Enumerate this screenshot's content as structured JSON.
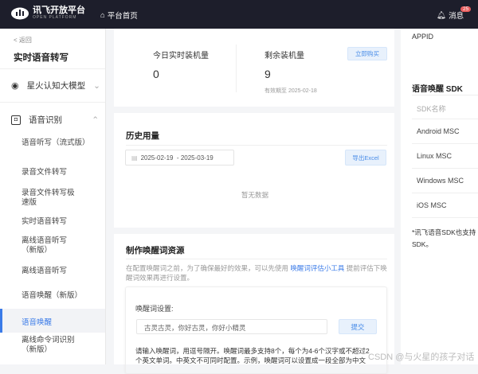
{
  "header": {
    "logo_title": "讯飞开放平台",
    "logo_sub": "OPEN PLATFORM",
    "home_label": "平台首页",
    "messages_label": "消息",
    "messages_count": "25"
  },
  "sidebar": {
    "back_label": "< 返回",
    "page_title": "实时语音转写",
    "groups": [
      {
        "label": "星火认知大模型"
      },
      {
        "label": "语音识别"
      }
    ],
    "items": [
      {
        "label": "语音听写（流式版）"
      },
      {
        "label": "录音文件转写"
      },
      {
        "label": "录音文件转写极速版"
      },
      {
        "label": "实时语音转写"
      },
      {
        "label": "离线语音听写（新版）"
      },
      {
        "label": "离线语音听写"
      },
      {
        "label": "语音唤醒（新版）"
      },
      {
        "label": "语音唤醒",
        "active": true
      },
      {
        "label": "离线命令词识别（新版）"
      }
    ]
  },
  "stats": {
    "today_label": "今日实时装机量",
    "today_value": "0",
    "remaining_label": "剩余装机量",
    "remaining_value": "9",
    "expiry": "有效期至 2025-02-18",
    "buy_label": "立即购买"
  },
  "history": {
    "title": "历史用量",
    "date_range": "2025-02-19  - 2025-03-19",
    "export_label": "导出Excel",
    "empty": "暂无数据"
  },
  "wakeword": {
    "title": "制作唤醒词资源",
    "desc_before": "在配置唤醒词之前，为了确保最好的效果，可以先使用 ",
    "desc_link": "唤醒词评估小工具",
    "desc_after": " 提前评估下唤醒词效果再进行设置。",
    "setting_label": "唤醒词设置:",
    "input_value": "古灵古灵，你好古灵，你好小精灵",
    "submit_label": "提交",
    "hint": "请输入唤醒词，用逗号隔开。唤醒词最多支持8个，每个为4-6个汉字或不超过2个英文单词。中英文不可同时配置。示例，唤醒词可以设置成一段全部为中文"
  },
  "right": {
    "appid_label": "APPID",
    "sdk_title": "语音唤醒 SDK",
    "sdk_header": "SDK名称",
    "sdks": [
      "Android MSC",
      "Linux MSC",
      "Windows MSC",
      "iOS MSC"
    ],
    "note": "*讯飞语音SDK也支持",
    "note2": "SDK。"
  },
  "watermark": "CSDN @与火星的孩子对话",
  "colors": {
    "header": "#1d1e2b",
    "accent": "#3b7be8",
    "badge": "#e85d5d"
  }
}
